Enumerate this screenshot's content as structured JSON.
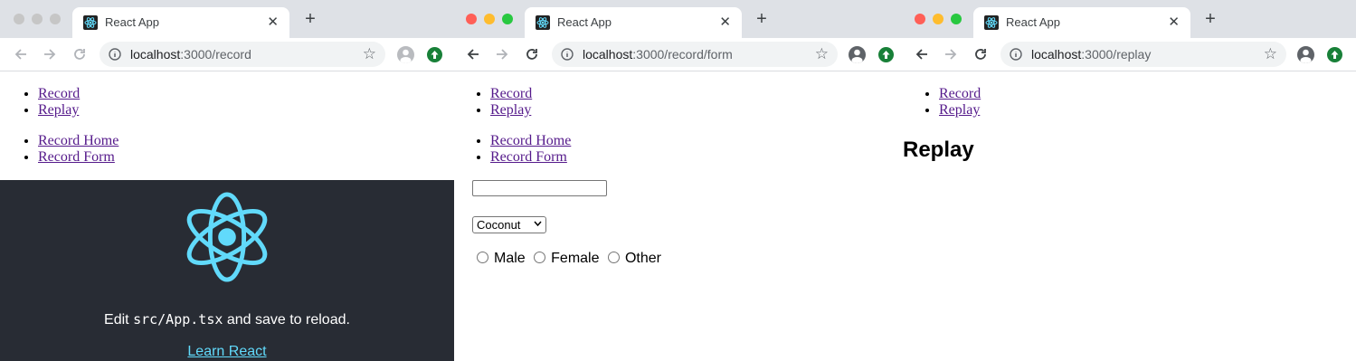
{
  "windows": [
    {
      "tab_title": "React App",
      "url_host": "localhost",
      "url_path": ":3000/record",
      "lights_active": false,
      "nav_links": [
        "Record",
        "Replay"
      ],
      "sub_links": [
        "Record Home",
        "Record Form"
      ],
      "app": {
        "edit_prefix": "Edit ",
        "edit_code": "src/App.tsx",
        "edit_suffix": " and save to reload.",
        "learn_link": "Learn React"
      }
    },
    {
      "tab_title": "React App",
      "url_host": "localhost",
      "url_path": ":3000/record/form",
      "lights_active": true,
      "nav_links": [
        "Record",
        "Replay"
      ],
      "sub_links": [
        "Record Home",
        "Record Form"
      ],
      "form": {
        "text_value": "",
        "select_value": "Coconut",
        "radios": [
          "Male",
          "Female",
          "Other"
        ]
      }
    },
    {
      "tab_title": "React App",
      "url_host": "localhost",
      "url_path": ":3000/replay",
      "lights_active": true,
      "nav_links": [
        "Record",
        "Replay"
      ],
      "heading": "Replay"
    }
  ],
  "colors": {
    "tabstrip": "#dee1e6",
    "link": "#551a8b",
    "app_bg": "#282c34",
    "react_blue": "#61dafb",
    "light_red": "#ff5f57",
    "light_yellow": "#febc2e",
    "light_green": "#28c840",
    "light_inactive": "#c6c6c6"
  },
  "icons": {
    "favicon": "react-logo-icon",
    "back": "arrow-left-icon",
    "forward": "arrow-right-icon",
    "reload": "reload-icon",
    "info": "info-icon",
    "bookmark": "star-icon",
    "profile": "avatar-icon",
    "extension": "upload-extension-icon"
  }
}
